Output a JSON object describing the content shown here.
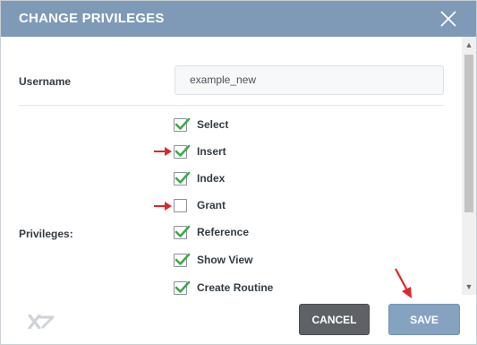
{
  "dialog": {
    "title": "CHANGE PRIVILEGES"
  },
  "form": {
    "username_label": "Username",
    "username_value": "example_new",
    "privileges_label": "Privileges:"
  },
  "privileges": [
    {
      "label": "Select",
      "checked": true
    },
    {
      "label": "Insert",
      "checked": true
    },
    {
      "label": "Index",
      "checked": true
    },
    {
      "label": "Grant",
      "checked": false
    },
    {
      "label": "Reference",
      "checked": true
    },
    {
      "label": "Show View",
      "checked": true
    },
    {
      "label": "Create Routine",
      "checked": true
    }
  ],
  "footer": {
    "cancel_label": "CANCEL",
    "save_label": "SAVE"
  },
  "colors": {
    "titlebar": "#7f9ab7",
    "check": "#3ea84a",
    "annotation_arrow": "#e0262b",
    "cancel_button": "#5e6266",
    "save_button": "#86a2c1"
  },
  "icons": {
    "close": "close-icon",
    "checkmark": "checkmark-icon",
    "logo": "app-logo-icon"
  }
}
